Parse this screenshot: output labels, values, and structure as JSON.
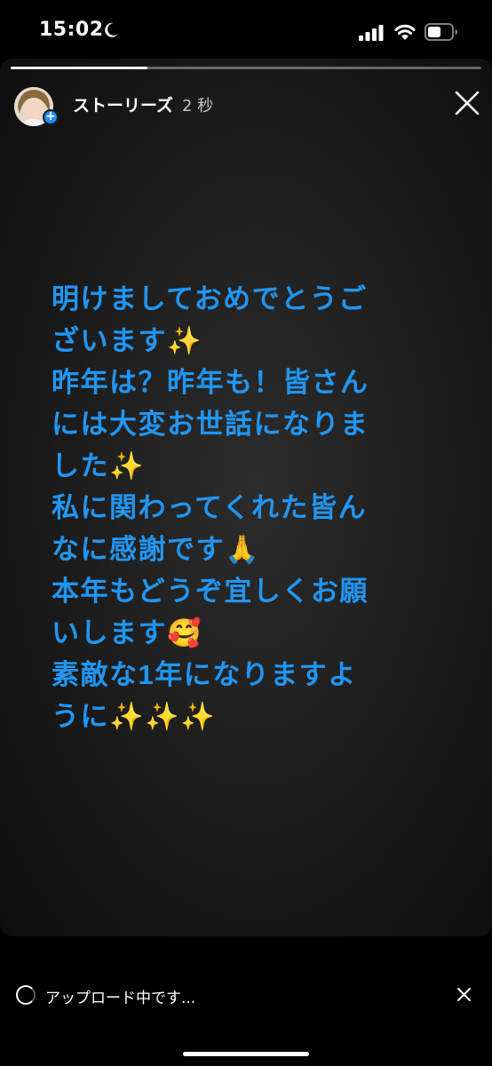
{
  "status_bar": {
    "time": "15:02"
  },
  "story": {
    "progress": 0.29,
    "user_name": "ストーリーズ",
    "elapsed": "2 秒",
    "text_lines": [
      "明けましておめでとうご",
      "ざいます✨",
      "昨年は？昨年も！皆さん",
      "には大変お世話になりま",
      "した✨",
      "私に関わってくれた皆ん",
      "なに感謝です🙏",
      "本年もどうぞ宜しくお願",
      "いします🥰",
      "素敵な1年になりますよ",
      "うに✨✨✨"
    ],
    "text_color": "#2196F3"
  },
  "upload_bar": {
    "label": "アップロード中です..."
  }
}
